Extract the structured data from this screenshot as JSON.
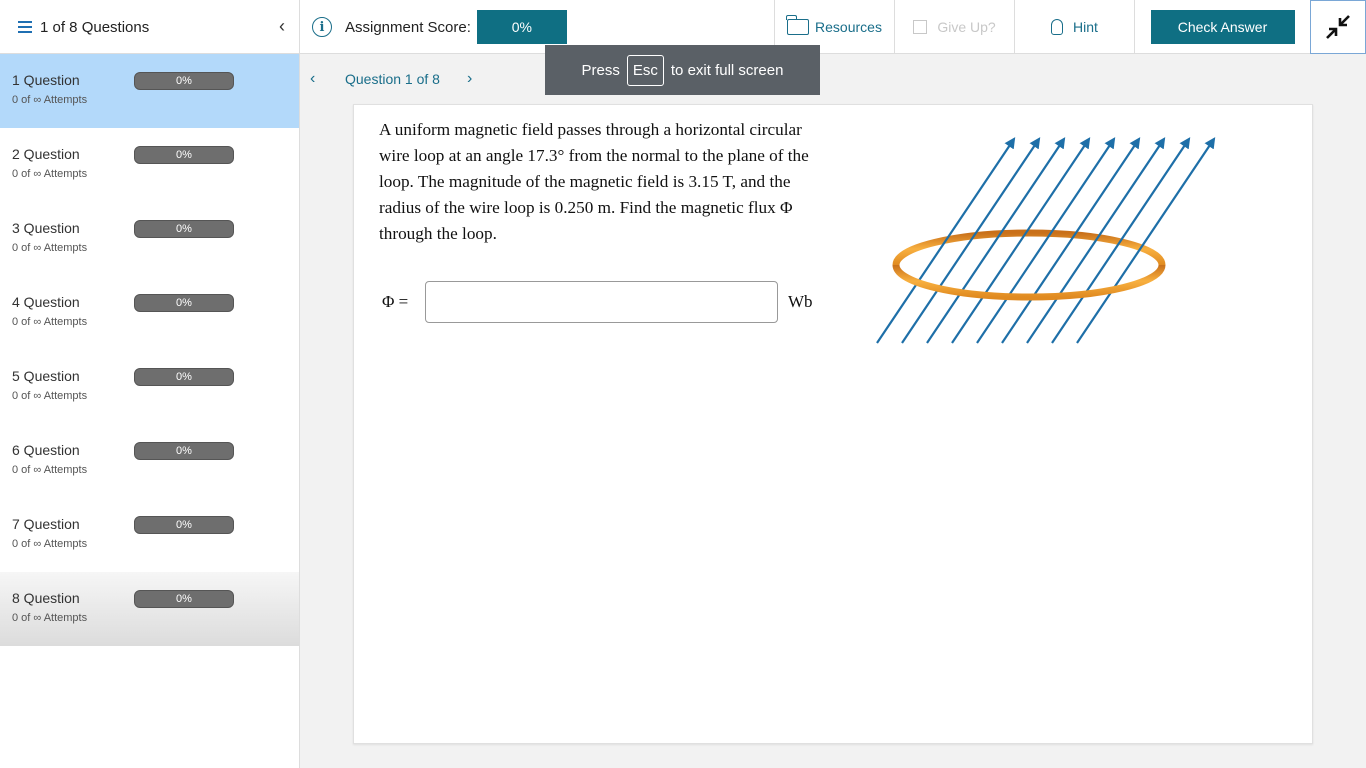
{
  "header": {
    "question_count": "1 of 8 Questions",
    "score_label": "Assignment Score:",
    "score_value": "0%",
    "resources_label": "Resources",
    "giveup_label": "Give Up?",
    "hint_label": "Hint",
    "check_label": "Check Answer"
  },
  "toast": {
    "prefix": "Press",
    "key": "Esc",
    "suffix": "to exit full screen"
  },
  "sidebar": {
    "items": [
      {
        "name": "1 Question",
        "attempts": "0 of ∞ Attempts",
        "score": "0%"
      },
      {
        "name": "2 Question",
        "attempts": "0 of ∞ Attempts",
        "score": "0%"
      },
      {
        "name": "3 Question",
        "attempts": "0 of ∞ Attempts",
        "score": "0%"
      },
      {
        "name": "4 Question",
        "attempts": "0 of ∞ Attempts",
        "score": "0%"
      },
      {
        "name": "5 Question",
        "attempts": "0 of ∞ Attempts",
        "score": "0%"
      },
      {
        "name": "6 Question",
        "attempts": "0 of ∞ Attempts",
        "score": "0%"
      },
      {
        "name": "7 Question",
        "attempts": "0 of ∞ Attempts",
        "score": "0%"
      },
      {
        "name": "8 Question",
        "attempts": "0 of ∞ Attempts",
        "score": "0%"
      }
    ]
  },
  "nav": {
    "question_label": "Question 1 of 8"
  },
  "question": {
    "text": "A uniform magnetic field passes through a horizontal circular wire loop at an angle 17.3° from the normal to the plane of the loop. The magnitude of the magnetic field is 3.15 T, and the radius of the wire loop is 0.250 m. Find the magnetic flux Φ through the loop.",
    "answer_symbol": "Φ =",
    "answer_value": "",
    "unit": "Wb"
  },
  "colors": {
    "accent": "#0f6f83",
    "link": "#1a6e8a",
    "active_row": "#b3d9fa",
    "field_lines": "#1e6fa8",
    "loop": "#f0a030"
  }
}
